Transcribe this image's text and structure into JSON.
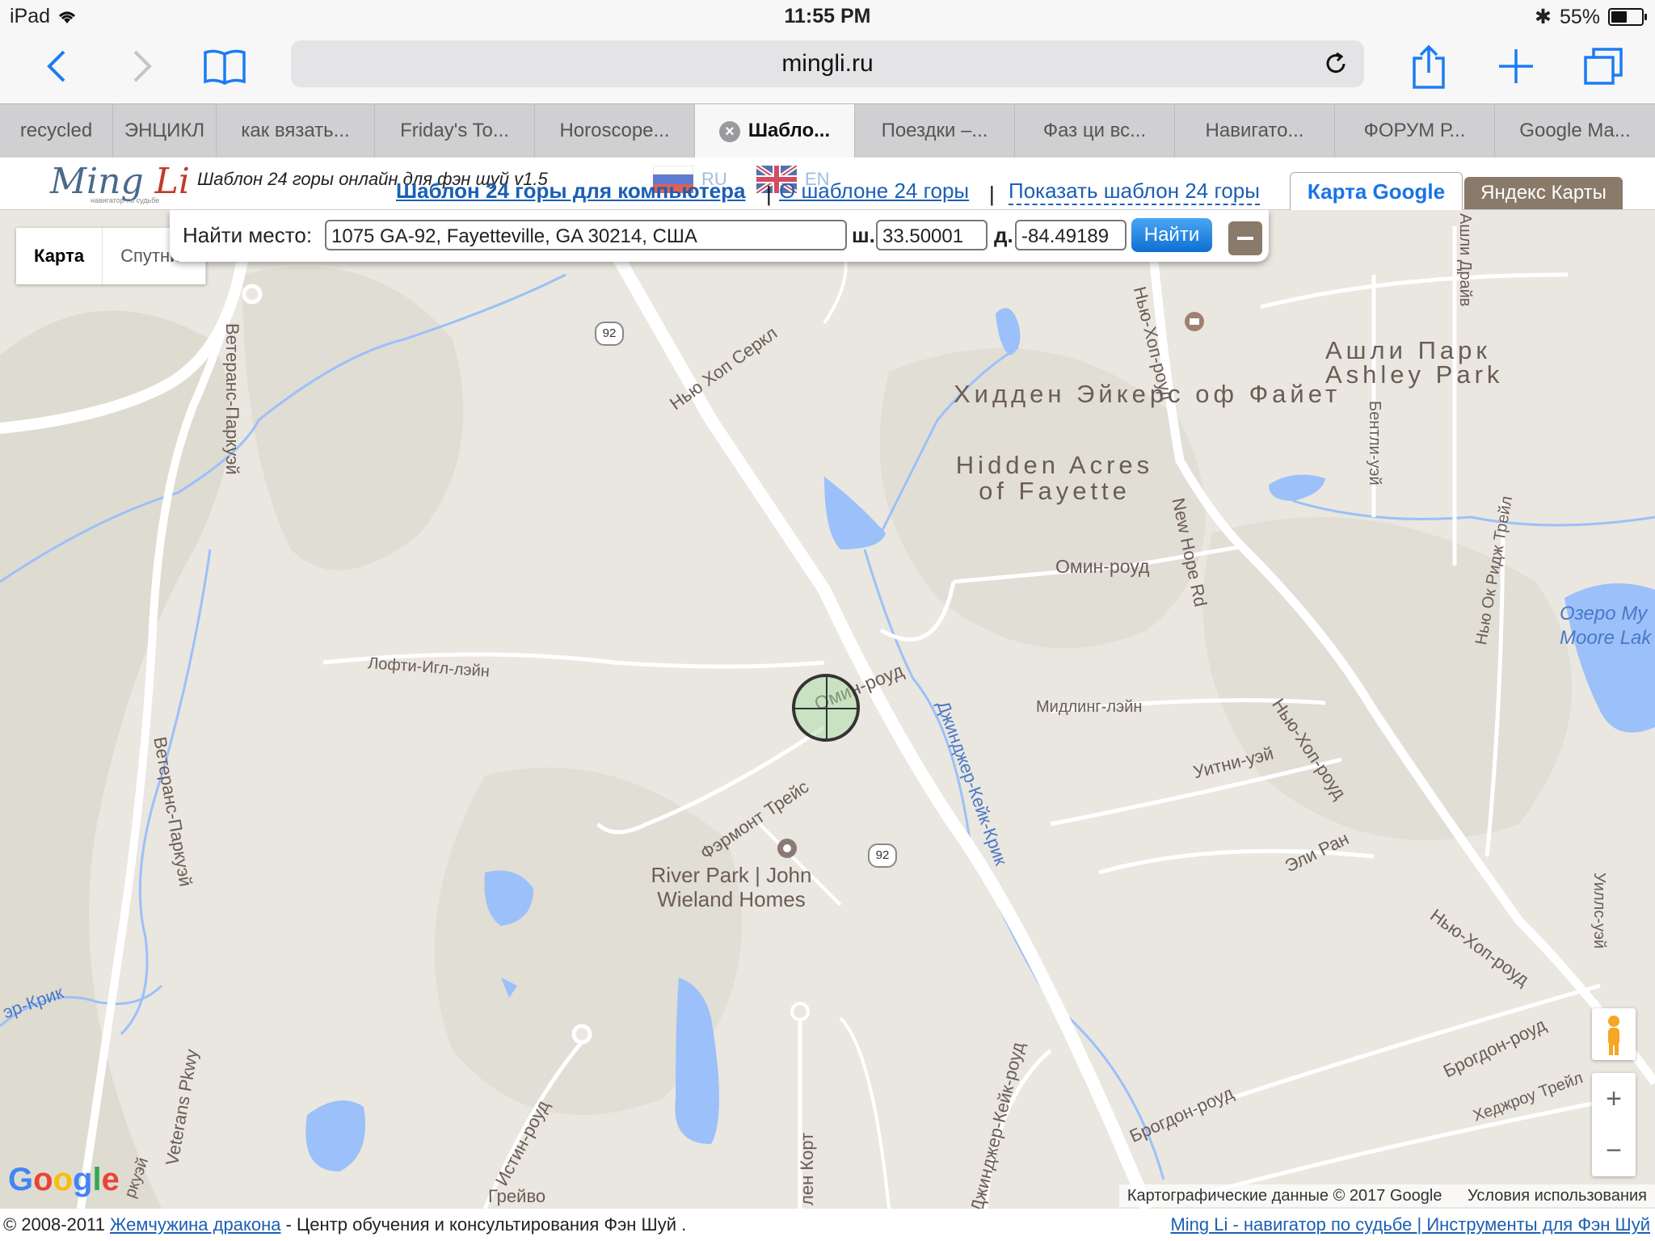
{
  "status": {
    "device": "iPad",
    "time": "11:55 PM",
    "battery": "55%",
    "battery_level": 0.55
  },
  "browser": {
    "url": "mingli.ru"
  },
  "tabs": [
    {
      "label": "recycled"
    },
    {
      "label": "ЭНЦИКЛ"
    },
    {
      "label": "как вязать..."
    },
    {
      "label": "Friday's To..."
    },
    {
      "label": "Horoscope..."
    },
    {
      "label": "Шабло...",
      "active": true
    },
    {
      "label": "Поездки –..."
    },
    {
      "label": "Фаз ци вс..."
    },
    {
      "label": "Навигато..."
    },
    {
      "label": "ФОРУМ Р..."
    },
    {
      "label": "Google Ma..."
    }
  ],
  "site": {
    "logo_text": "Ming",
    "logo_accent": "Li",
    "logo_sub": "навигатор по судьбе",
    "title": "Шаблон 24 горы онлайн для фэн шуй v1.5",
    "lang_ru": "RU",
    "lang_en": "EN",
    "link_computer": "Шаблон 24 горы для компьютера",
    "link_about": "О шаблоне 24 горы",
    "link_show": "Показать шаблон 24 горы",
    "sep": "|",
    "tab_google": "Карта Google",
    "tab_yandex": "Яндекс Карты"
  },
  "find": {
    "label": "Найти место:",
    "address": "1075 GA-92, Fayetteville, GA 30214, США",
    "lat_label": "ш.",
    "lat": "33.50001",
    "lng_label": "д.",
    "lng": "-84.49189",
    "button": "Найти"
  },
  "map_type": {
    "map": "Карта",
    "satellite": "Спутник"
  },
  "map_labels": {
    "veterans1": "Ветеранс-Паркуэй",
    "veterans2": "Ветеранс-Паркуэй",
    "veterans_en": "Veterans Pkwy",
    "hwy92a": "92",
    "hwy92b": "92",
    "new_hope_circle": "Нью Хоп Серкл",
    "hidden_ru": "Хидден Эйкерс оф Файет",
    "hidden_en": "Hidden Acres of Fayette",
    "ashley_ru": "Ашли Парк",
    "ashley_en": "Ashley Park",
    "ashley_drive": "Ашли Драйв",
    "new_hope_road1": "Нью-Хоп-роуд",
    "new_hope_rd_en": "New Hope Rd",
    "new_hope_road2": "Нью-Хоп-роуд",
    "new_hope_road3": "Нью-Хоп-роуд",
    "bentley": "Бентли-уэй",
    "omin1": "Омин-роуд",
    "omin2": "Омин-роуд",
    "lofty": "Лофти-Игл-лэйн",
    "midling": "Мидлинг-лэйн",
    "witney": "Уитни-уэй",
    "eli": "Эли Ран",
    "ginger": "Джинджер-Кейк-Крик",
    "fairmont": "Фэрмонт Трейс",
    "river_park": "River Park | John Wieland Homes",
    "lake_ru": "Озеро My",
    "lake_en": "Moore Lak",
    "new_oak_ridge": "Нью Ок Ридж Трейл",
    "willis": "Уиллс-уэй",
    "brogdon1": "Брогдон-роуд",
    "brogdon2": "Брогдон-роуд",
    "hedgerow": "Хеджроу Трейл",
    "istin": "Истин-роуд",
    "grey": "Грейво",
    "ginger_road": "Джинджер-Кейк-роуд",
    "glen_court": "лен Корт",
    "creek_left": "эр-Крик",
    "parkway_bottom": "ркуэй"
  },
  "map_footer": {
    "google": "Google",
    "data": "Картографические данные © 2017 Google",
    "terms": "Условия использования"
  },
  "footer": {
    "copyright": "© 2008-2011",
    "link1": "Жемчужина дракона",
    "text": "- Центр обучения и консультирования Фэн Шуй .",
    "right": "Ming Li - навигатор по судьбе | Инструменты для Фэн Шуй"
  },
  "colors": {
    "link": "#1a5fb4",
    "water": "#9cc0f9",
    "road": "#ffffff",
    "land": "#e9e7df",
    "label": "#6a5c57"
  }
}
